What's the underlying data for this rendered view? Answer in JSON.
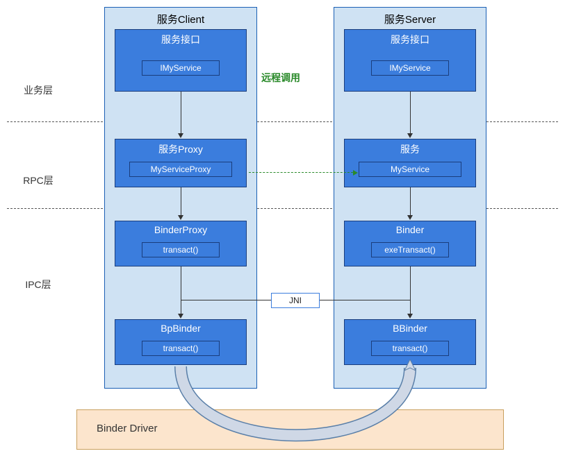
{
  "layers": {
    "biz": "业务层",
    "rpc": "RPC层",
    "ipc": "IPC层"
  },
  "remote_call_label": "远程调用",
  "jni_label": "JNI",
  "driver_label": "Binder Driver",
  "client": {
    "title": "服务Client",
    "iface": {
      "title": "服务接口",
      "inner": "IMyService"
    },
    "proxy": {
      "title": "服务Proxy",
      "inner": "MyServiceProxy"
    },
    "binderproxy": {
      "title": "BinderProxy",
      "inner": "transact()"
    },
    "bpbinder": {
      "title": "BpBinder",
      "inner": "transact()"
    }
  },
  "server": {
    "title": "服务Server",
    "iface": {
      "title": "服务接口",
      "inner": "IMyService"
    },
    "service": {
      "title": "服务",
      "inner": "MyService"
    },
    "binder": {
      "title": "Binder",
      "inner": "exeTransact()"
    },
    "bbinder": {
      "title": "BBinder",
      "inner": "transact()"
    }
  }
}
